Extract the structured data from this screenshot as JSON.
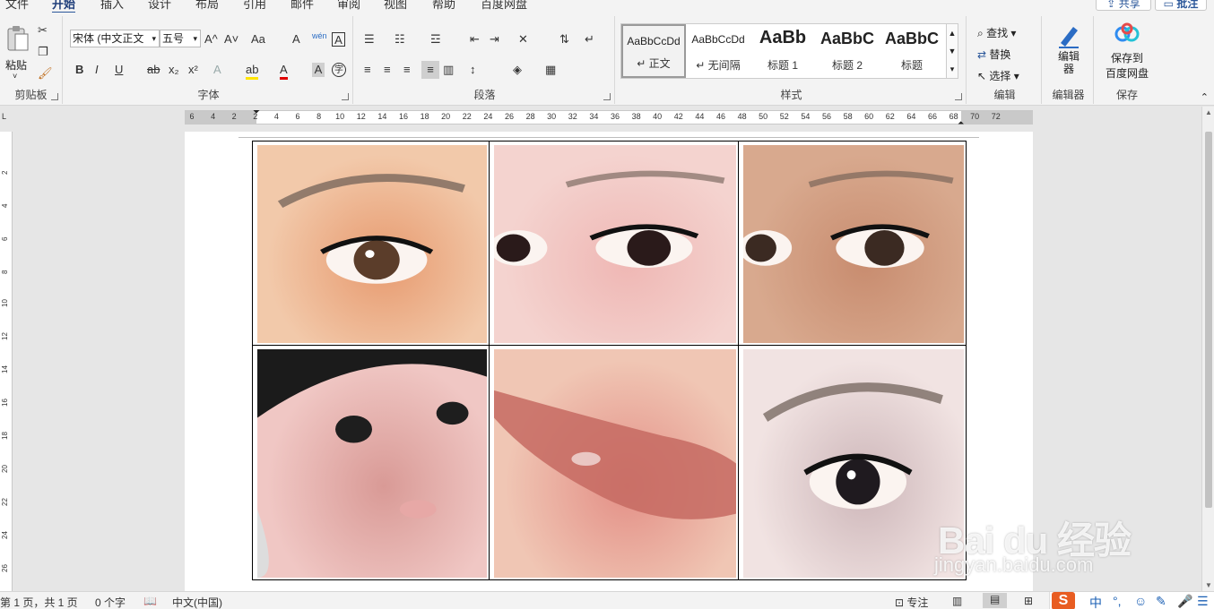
{
  "tabs": [
    {
      "label": "文件"
    },
    {
      "label": "开始"
    },
    {
      "label": "插入"
    },
    {
      "label": "设计"
    },
    {
      "label": "布局"
    },
    {
      "label": "引用"
    },
    {
      "label": "邮件"
    },
    {
      "label": "审阅"
    },
    {
      "label": "视图"
    },
    {
      "label": "帮助"
    },
    {
      "label": "百度网盘"
    }
  ],
  "top_buttons": {
    "share": "共享",
    "comment": "批注"
  },
  "ribbon": {
    "clipboard": {
      "label": "剪贴板",
      "paste": "粘贴"
    },
    "font": {
      "label": "字体",
      "font_name": "宋体 (中文正文",
      "font_size": "五号",
      "row1_glyphs": [
        "A^",
        "A˅",
        "Aa",
        "A",
        "wén",
        "A"
      ],
      "row2_glyphs": [
        "B",
        "I",
        "U",
        "ab",
        "x₂",
        "x²",
        "A",
        "ab",
        "A",
        "A",
        "字"
      ]
    },
    "paragraph": {
      "label": "段落"
    },
    "styles": {
      "label": "样式",
      "items": [
        {
          "sample": "AaBbCcDd",
          "name": "↵ 正文"
        },
        {
          "sample": "AaBbCcDd",
          "name": "↵ 无间隔"
        },
        {
          "sample": "AaBb",
          "name": "标题 1"
        },
        {
          "sample": "AaBbC",
          "name": "标题 2"
        },
        {
          "sample": "AaBbC",
          "name": "标题"
        }
      ]
    },
    "editing": {
      "label": "编辑",
      "find": "查找",
      "replace": "替换",
      "select": "选择"
    },
    "editor": {
      "label": "编辑器",
      "button": "编辑器"
    },
    "save": {
      "label": "保存",
      "button_line1": "保存到",
      "button_line2": "百度网盘"
    }
  },
  "ruler": {
    "corner": "L",
    "h_numbers": [
      "6",
      "4",
      "2",
      "2",
      "4",
      "6",
      "8",
      "10",
      "12",
      "14",
      "16",
      "18",
      "20",
      "22",
      "24",
      "26",
      "28",
      "30",
      "32",
      "34",
      "36",
      "38",
      "40",
      "42",
      "44",
      "46",
      "48",
      "50",
      "52",
      "54",
      "56",
      "58",
      "60",
      "62",
      "64",
      "66",
      "68",
      "70",
      "72"
    ],
    "v_numbers": [
      "2",
      "4",
      "6",
      "8",
      "10",
      "12",
      "14",
      "16",
      "18",
      "20",
      "22",
      "24",
      "26",
      "28"
    ]
  },
  "document": {
    "images": [
      {
        "subject": "orange-eyeshadow-eye",
        "colors": [
          "#f2c9aa",
          "#e79a6f",
          "#5b3d2a"
        ]
      },
      {
        "subject": "woman-eyes-lashes",
        "colors": [
          "#f4d3cf",
          "#efb7b4",
          "#2a1a1a"
        ]
      },
      {
        "subject": "natural-eyes",
        "colors": [
          "#d8a98e",
          "#c88c6f",
          "#3b2a22"
        ]
      },
      {
        "subject": "baby-face",
        "colors": [
          "#f0c7c4",
          "#d99a96",
          "#1e1e1e"
        ]
      },
      {
        "subject": "glossy-lips",
        "colors": [
          "#f0c6b4",
          "#e38f86",
          "#c66a62"
        ]
      },
      {
        "subject": "eye-with-makeup",
        "colors": [
          "#f1e3e2",
          "#cdb6b9",
          "#1f1a1f"
        ]
      }
    ]
  },
  "watermark": {
    "line1": "Bai du 经验",
    "line2": "jingyan.baidu.com"
  },
  "status": {
    "page": "第 1 页，共 1 页",
    "words": "0 个字",
    "language": "中文(中国)",
    "focus": "专注",
    "ime": {
      "mode": "中",
      "punct": "°,"
    }
  }
}
